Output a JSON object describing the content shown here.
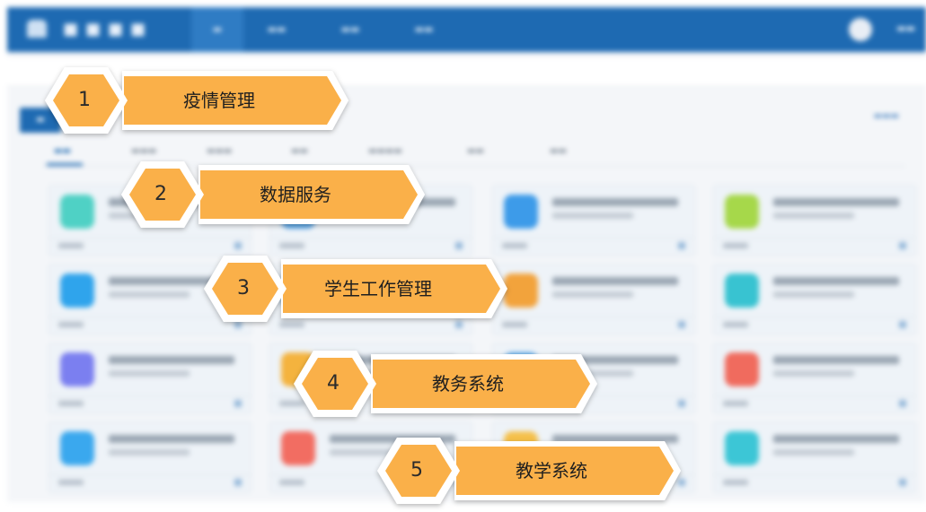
{
  "colors": {
    "accent_orange": "#f9b24b",
    "header_blue": "#1e6ab2",
    "hex_fill": "#fab04a"
  },
  "callouts": [
    {
      "number": "1",
      "label": "疫情管理"
    },
    {
      "number": "2",
      "label": "数据服务"
    },
    {
      "number": "3",
      "label": "学生工作管理"
    },
    {
      "number": "4",
      "label": "教务系统"
    },
    {
      "number": "5",
      "label": "教学系统"
    }
  ]
}
